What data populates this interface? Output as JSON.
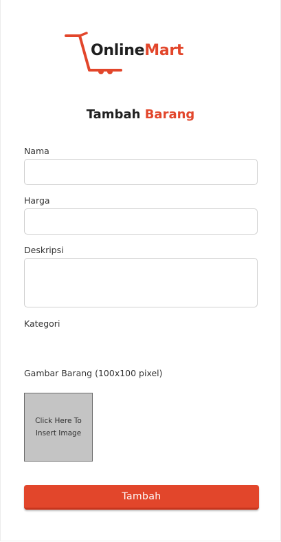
{
  "brand": {
    "name_part1": "Online",
    "name_part2": "Mart",
    "accent_color": "#e2462b",
    "icon": "shopping-cart-icon"
  },
  "page": {
    "title_part1": "Tambah",
    "title_part2": "Barang"
  },
  "form": {
    "nama_label": "Nama",
    "nama_value": "",
    "harga_label": "Harga",
    "harga_value": "",
    "deskripsi_label": "Deskripsi",
    "deskripsi_value": "",
    "kategori_label": "Kategori",
    "gambar_label": "Gambar Barang (100x100 pixel)",
    "image_placeholder": "Click Here To Insert Image",
    "submit_label": "Tambah"
  }
}
